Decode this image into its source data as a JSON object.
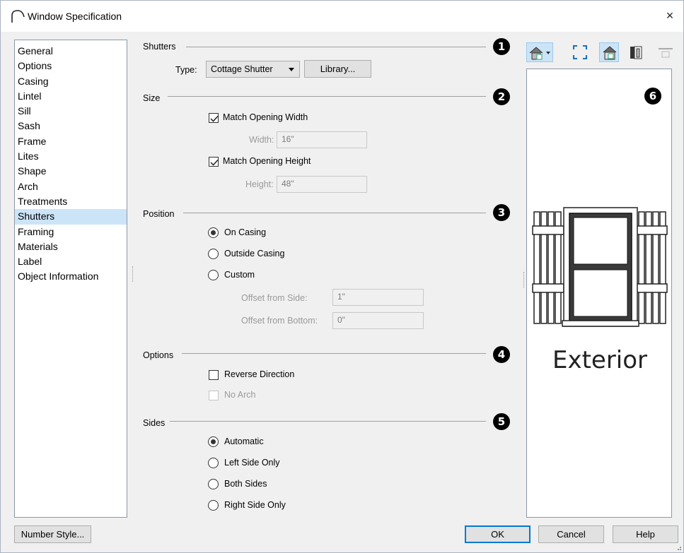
{
  "window": {
    "title": "Window Specification",
    "close": "×"
  },
  "sidebar": {
    "items": [
      {
        "label": "General"
      },
      {
        "label": "Options"
      },
      {
        "label": "Casing"
      },
      {
        "label": "Lintel"
      },
      {
        "label": "Sill"
      },
      {
        "label": "Sash"
      },
      {
        "label": "Frame"
      },
      {
        "label": "Lites"
      },
      {
        "label": "Shape"
      },
      {
        "label": "Arch"
      },
      {
        "label": "Treatments"
      },
      {
        "label": "Shutters"
      },
      {
        "label": "Framing"
      },
      {
        "label": "Materials"
      },
      {
        "label": "Label"
      },
      {
        "label": "Object Information"
      }
    ],
    "selected": "Shutters"
  },
  "shutters": {
    "title": "Shutters",
    "badge": "1",
    "type_label": "Type:",
    "type_value": "Cottage Shutter",
    "library_button": "Library..."
  },
  "size": {
    "title": "Size",
    "badge": "2",
    "match_width_label": "Match Opening Width",
    "match_width_checked": true,
    "width_label": "Width:",
    "width_value": "16\"",
    "match_height_label": "Match Opening Height",
    "match_height_checked": true,
    "height_label": "Height:",
    "height_value": "48\""
  },
  "position": {
    "title": "Position",
    "badge": "3",
    "options": [
      "On Casing",
      "Outside Casing",
      "Custom"
    ],
    "selected": "On Casing",
    "offset_side_label": "Offset from Side:",
    "offset_side_value": "1\"",
    "offset_bottom_label": "Offset from Bottom:",
    "offset_bottom_value": "0\""
  },
  "options": {
    "title": "Options",
    "badge": "4",
    "reverse_label": "Reverse Direction",
    "reverse_checked": false,
    "no_arch_label": "No Arch",
    "no_arch_disabled": true
  },
  "sides": {
    "title": "Sides",
    "badge": "5",
    "options": [
      "Automatic",
      "Left Side Only",
      "Both Sides",
      "Right Side Only"
    ],
    "selected": "Automatic"
  },
  "preview": {
    "badge": "6",
    "caption": "Exterior",
    "toolbar": [
      "view-mode-dropdown-icon",
      "fill-window-icon",
      "exterior-view-icon",
      "interior-view-icon",
      "section-view-icon"
    ]
  },
  "footer": {
    "number_style_button": "Number Style...",
    "ok_button": "OK",
    "cancel_button": "Cancel",
    "help_button": "Help"
  },
  "colors": {
    "selection": "#cce4f7",
    "accent": "#0078d7",
    "dialog_bg": "#f0f0f0"
  }
}
